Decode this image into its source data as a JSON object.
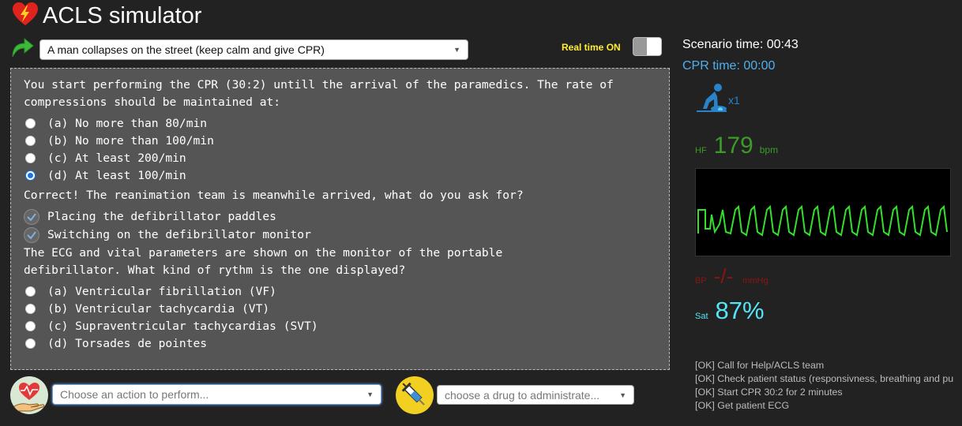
{
  "app": {
    "title": "ACLS simulator"
  },
  "scenario": {
    "selected": "A man collapses on the street (keep calm and give CPR)",
    "realtime_label": "Real time ON"
  },
  "question_panel": {
    "question1": "You start performing the CPR (30:2) untill the arrival of the paramedics. The rate of compressions should be maintained at:",
    "options1": [
      {
        "label": "(a) No more than 80/min",
        "checked": false
      },
      {
        "label": "(b) No more than 100/min",
        "checked": false
      },
      {
        "label": "(c) At least 200/min",
        "checked": false
      },
      {
        "label": "(d) At least 100/min",
        "checked": true
      }
    ],
    "feedback1": "Correct! The reanimation team is meanwhile arrived, what do you ask for?",
    "requests": [
      "Placing the defibrillator paddles",
      "Switching on the defibrillator monitor"
    ],
    "question2": "The ECG and vital parameters are shown on the monitor of the portable defibrillator. What kind of rythm is the one displayed?",
    "options2": [
      {
        "label": "(a) Ventricular fibrillation (VF)",
        "checked": false
      },
      {
        "label": "(b) Ventricular tachycardia (VT)",
        "checked": false
      },
      {
        "label": "(c) Supraventricular tachycardias (SVT)",
        "checked": false
      },
      {
        "label": "(d) Torsades de pointes",
        "checked": false
      }
    ]
  },
  "actions": {
    "action_placeholder": "Choose an action to perform...",
    "drug_placeholder": "choose a drug to administrate..."
  },
  "status": {
    "scenario_time": "Scenario time: 00:43",
    "cpr_time": "CPR time: 00:00",
    "cpr_count": "x1"
  },
  "vitals": {
    "hf_label": "HF",
    "hf_value": "179",
    "hf_unit": "bpm",
    "bp_label": "BP",
    "bp_value": "-/-",
    "bp_unit": "mmHg",
    "sat_label": "Sat",
    "sat_value": "87%"
  },
  "log": [
    "[OK] Call for Help/ACLS team",
    "[OK] Check patient status (responsivness, breathing and pu",
    "[OK] Start CPR 30:2 for 2 minutes",
    "[OK] Get patient ECG"
  ],
  "colors": {
    "background": "#222222",
    "panel": "#555555",
    "hf": "#3c9b28",
    "bp": "#8b1515",
    "sat": "#55e5f5",
    "cpr_time": "#4fb0f0",
    "realtime": "#ffee33",
    "ecg_trace": "#33e02a"
  },
  "icons": {
    "app_logo": "heart-lightning-icon",
    "scenario_go": "green-arrow-icon",
    "cpr": "cpr-person-icon",
    "action": "heart-hand-icon",
    "drug": "syringe-icon"
  }
}
